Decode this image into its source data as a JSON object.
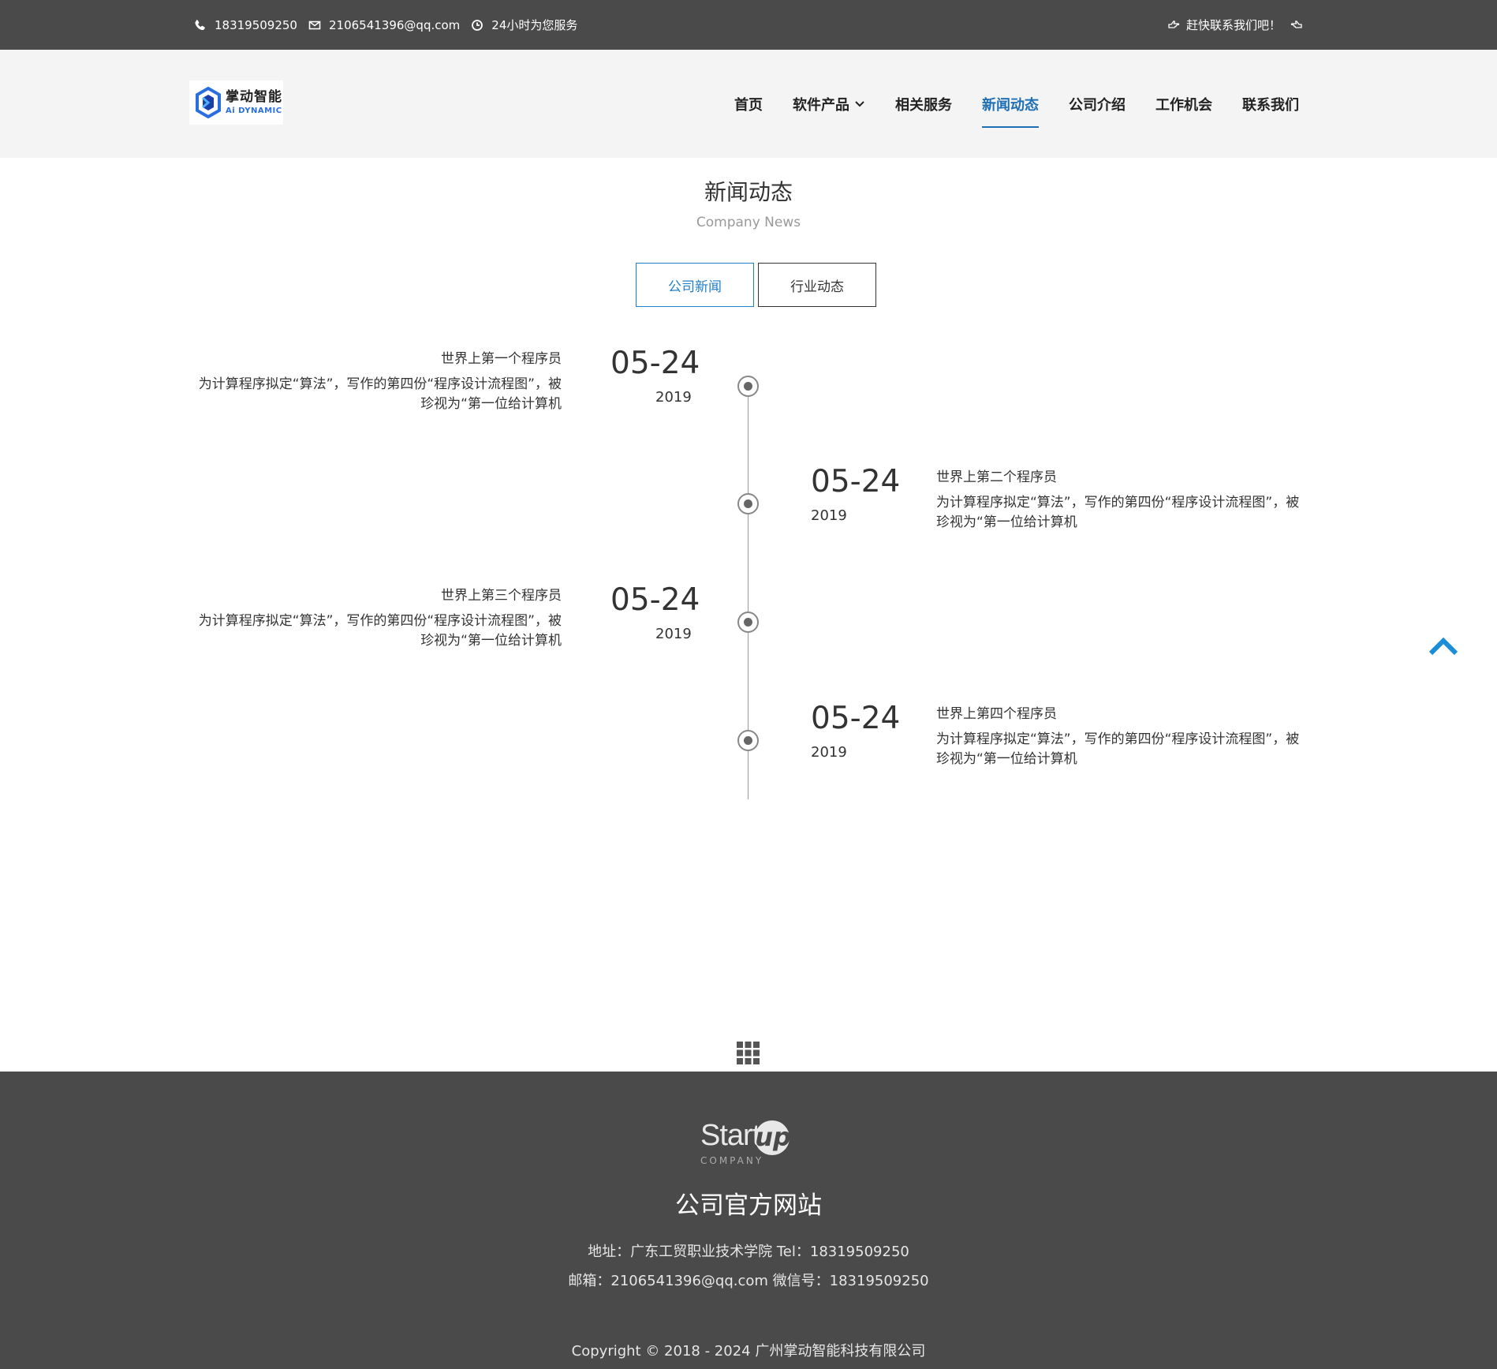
{
  "topbar": {
    "phone": "18319509250",
    "email": "2106541396@qq.com",
    "service": "24小时为您服务",
    "cta": "赶快联系我们吧！",
    "icons": [
      "phone-icon",
      "mail-icon",
      "clock-icon",
      "hand-point-right-icon",
      "hand-point-left-icon"
    ]
  },
  "logo": {
    "cn": "掌动智能",
    "en": "Ai DYNAMIC"
  },
  "nav": {
    "items": [
      {
        "label": "首页"
      },
      {
        "label": "软件产品"
      },
      {
        "label": "相关服务"
      },
      {
        "label": "新闻动态"
      },
      {
        "label": "公司介绍"
      },
      {
        "label": "工作机会"
      },
      {
        "label": "联系我们"
      }
    ],
    "active": "新闻动态"
  },
  "section": {
    "title": "新闻动态",
    "subtitle": "Company News"
  },
  "tabs": [
    {
      "label": "公司新闻",
      "active": true
    },
    {
      "label": "行业动态",
      "active": false
    }
  ],
  "news": [
    {
      "date": "05-24",
      "year": "2019",
      "title": "世界上第一个程序员",
      "desc": "为计算程序拟定“算法”，写作的第四份“程序设计流程图”，被珍视为“第一位给计算机"
    },
    {
      "date": "05-24",
      "year": "2019",
      "title": "世界上第二个程序员",
      "desc": "为计算程序拟定“算法”，写作的第四份“程序设计流程图”，被珍视为“第一位给计算机"
    },
    {
      "date": "05-24",
      "year": "2019",
      "title": "世界上第三个程序员",
      "desc": "为计算程序拟定“算法”，写作的第四份“程序设计流程图”，被珍视为“第一位给计算机"
    },
    {
      "date": "05-24",
      "year": "2019",
      "title": "世界上第四个程序员",
      "desc": "为计算程序拟定“算法”，写作的第四份“程序设计流程图”，被珍视为“第一位给计算机"
    }
  ],
  "footer": {
    "logo_word": "Start",
    "logo_up": "up",
    "logo_company": "COMPANY",
    "site_name": "公司官方网站",
    "address_line": "地址：广东工贸职业技术学院 Tel：18319509250",
    "email_line": "邮箱：2106541396@qq.com 微信号：18319509250",
    "copyright": "Copyright © 2018 - 2024 广州掌动智能科技有限公司"
  },
  "colors": {
    "topbar_bg": "#4a4a4a",
    "header_bg": "#f4f4f4",
    "accent": "#1f6fb5",
    "backtop": "#1a8fd8",
    "footer_bg": "#4a4a4a"
  }
}
